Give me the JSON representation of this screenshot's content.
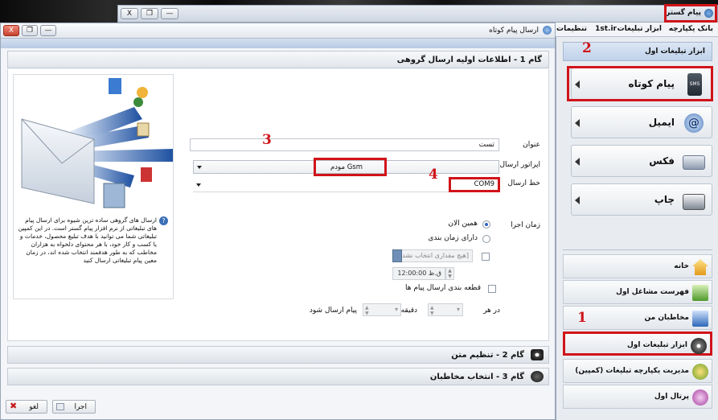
{
  "app": {
    "title": "پیام گستر"
  },
  "window_buttons": {
    "close": "X",
    "restore": "❐",
    "minimize": "—"
  },
  "menu": [
    "بانک یکپارچه",
    "ابزار تبلیغات",
    "1st.ir",
    "تنظیمات"
  ],
  "child_window": {
    "title": "ارسال پیام کوتاه"
  },
  "step1": {
    "title": "گام 1 - اطلاعات اولیه ارسال گروهی"
  },
  "form": {
    "title_label": "عنوان",
    "title_value": "تست",
    "operator_label": "اپراتور ارسال",
    "operator_value": "مودم Gsm",
    "line_label": "خط ارسال",
    "line_value": "COM9",
    "exec_time_label": "زمان اجرا",
    "radio_now": "همین الان",
    "radio_scheduled": "دارای زمان بندی",
    "no_value_selected": "[هیچ مقداری انتخاب نشد]",
    "date_prefix": "ق.ظ",
    "time_value": "12:00:00",
    "chunk_label": "قطعه بندی ارسال پیام ها",
    "every_label": "در هر",
    "minute_label": "دقیقه",
    "send_label": "پیام ارسال شود"
  },
  "help_text": "ارسال های گروهی ساده ترین شیوه برای ارسال پیام های تبلیغاتی از نرم افزار پیام گستر است. در این کمپین تبلیغاتی شما می توانید با هدف تبلیغ محصول، خدمات و یا کسب و کار خود، با هر محتوای دلخواه به هزاران مخاطب که به طور هدفمند انتخاب شده اند، در زمان معین پیام تبلیغاتی ارسال کنید",
  "step2": {
    "title": "گام 2 - تنظیم متن"
  },
  "step3": {
    "title": "گام 3 - انتخاب مخاطبان"
  },
  "buttons": {
    "execute": "اجرا",
    "cancel": "لغو"
  },
  "right_panel": {
    "header": "ابزار تبلیغات اول",
    "tools": [
      {
        "label": "پیام کوتاه",
        "icon": "sms-phone-icon"
      },
      {
        "label": "ایمیل",
        "icon": "email-icon"
      },
      {
        "label": "فکس",
        "icon": "fax-icon"
      },
      {
        "label": "چاپ",
        "icon": "printer-icon"
      }
    ],
    "nav": [
      {
        "label": "خانه",
        "icon": "home-icon"
      },
      {
        "label": "فهرست مشاغل اول",
        "icon": "business-list-icon"
      },
      {
        "label": "مخاطبان من",
        "icon": "contacts-icon"
      },
      {
        "label": "ابزار تبلیغات اول",
        "icon": "advertising-tools-icon"
      },
      {
        "label": "مدیریت یکپارچه تبلیغات (کمپین)",
        "icon": "campaign-icon"
      },
      {
        "label": "پرتال اول",
        "icon": "portal-icon"
      }
    ]
  },
  "annotations": [
    "1",
    "2",
    "3",
    "4"
  ],
  "colors": {
    "annotation_red": "#d0141a",
    "accent_blue": "#3a6fb5"
  }
}
